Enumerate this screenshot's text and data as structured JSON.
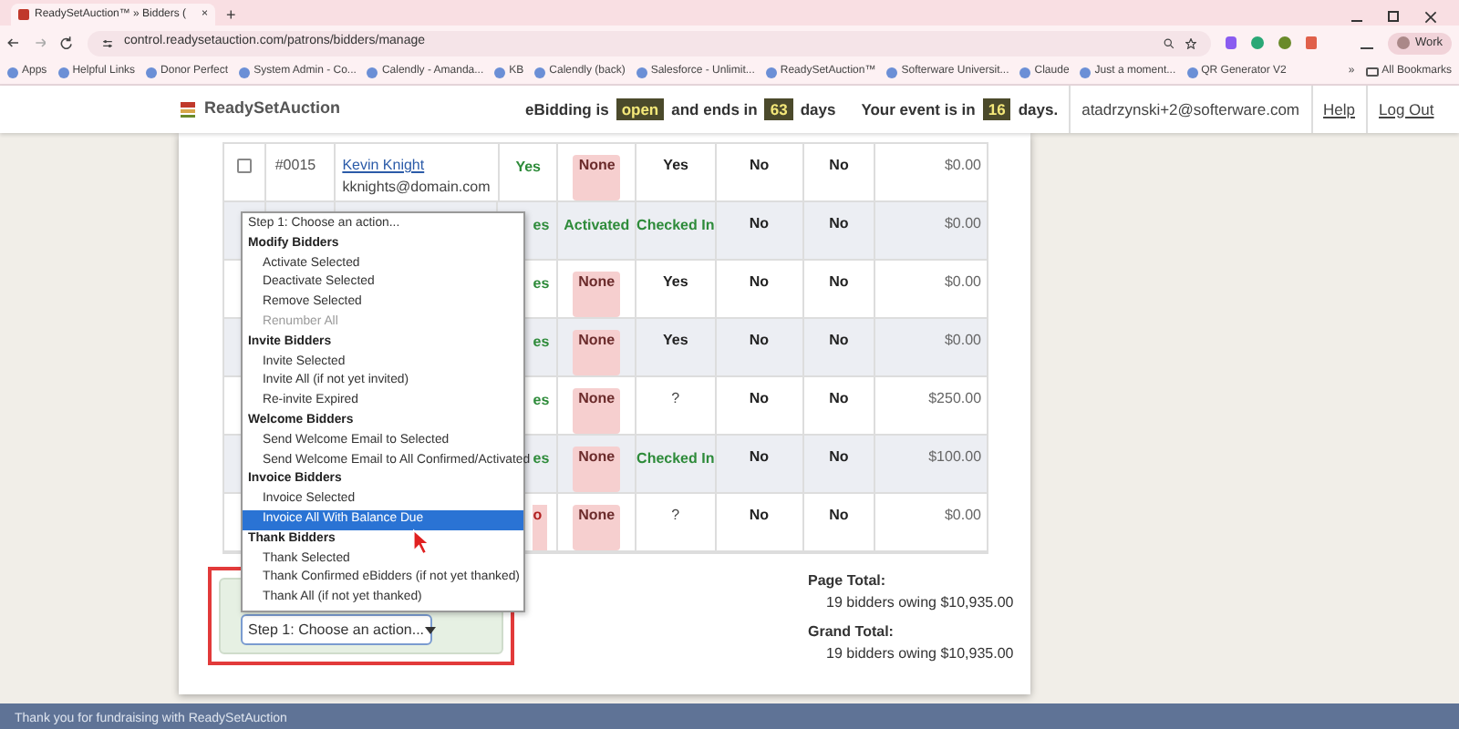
{
  "browser": {
    "tab": {
      "title": "ReadySetAuction™ » Bidders (",
      "close": "×"
    },
    "new_tab": "+",
    "url": "control.readysetauction.com/patrons/bidders/manage",
    "profile": "Work",
    "bookmarks": [
      "Apps",
      "Helpful Links",
      "Donor Perfect",
      "System Admin - Co...",
      "Calendly - Amanda...",
      "KB",
      "Calendly (back)",
      "Salesforce - Unlimit...",
      "ReadySetAuction™",
      "Softerware Universit...",
      "Claude",
      "Just a moment...",
      "QR Generator V2"
    ],
    "more": "»",
    "all_bookmarks": "All Bookmarks"
  },
  "header": {
    "logo": "ReadySetAuction",
    "status": [
      {
        "kind": "text",
        "text": "eBidding is"
      },
      {
        "kind": "pill",
        "text": "open"
      },
      {
        "kind": "text",
        "text": "and ends in"
      },
      {
        "kind": "pill",
        "text": "63"
      },
      {
        "kind": "text",
        "text": "days"
      },
      {
        "kind": "text",
        "text": "Your event is in"
      },
      {
        "kind": "pill",
        "text": "16"
      },
      {
        "kind": "text",
        "text": "days."
      }
    ],
    "user": "atadrzynski+2@softerware.com",
    "links": [
      "Help",
      "Log Out"
    ]
  },
  "table": {
    "rows": [
      {
        "checked": false,
        "number": "#0015",
        "name": "Kevin Knight",
        "email": "kknights@domain.com",
        "cells": [
          {
            "kind": "green",
            "text": "Yes"
          },
          {
            "kind": "pill",
            "text": "None"
          },
          {
            "kind": "bold",
            "text": "Yes"
          },
          {
            "kind": "bold",
            "text": "No"
          },
          {
            "kind": "bold",
            "text": "No"
          }
        ],
        "amount": "$0.00"
      },
      {
        "cells": [
          {
            "kind": "green",
            "text": "es"
          },
          {
            "kind": "green",
            "text": "Activated"
          },
          {
            "kind": "green",
            "text": "Checked In"
          },
          {
            "kind": "bold",
            "text": "No"
          },
          {
            "kind": "bold",
            "text": "No"
          }
        ],
        "amount": "$0.00"
      },
      {
        "cells": [
          {
            "kind": "green",
            "text": "es"
          },
          {
            "kind": "pill",
            "text": "None"
          },
          {
            "kind": "bold",
            "text": "Yes"
          },
          {
            "kind": "bold",
            "text": "No"
          },
          {
            "kind": "bold",
            "text": "No"
          }
        ],
        "amount": "$0.00"
      },
      {
        "cells": [
          {
            "kind": "green",
            "text": "es"
          },
          {
            "kind": "pill",
            "text": "None"
          },
          {
            "kind": "bold",
            "text": "Yes"
          },
          {
            "kind": "bold",
            "text": "No"
          },
          {
            "kind": "bold",
            "text": "No"
          }
        ],
        "amount": "$0.00"
      },
      {
        "cells": [
          {
            "kind": "green",
            "text": "es"
          },
          {
            "kind": "pill",
            "text": "None"
          },
          {
            "kind": "plain",
            "text": "?"
          },
          {
            "kind": "bold",
            "text": "No"
          },
          {
            "kind": "bold",
            "text": "No"
          }
        ],
        "amount": "$250.00"
      },
      {
        "cells": [
          {
            "kind": "green",
            "text": "es"
          },
          {
            "kind": "pill",
            "text": "None"
          },
          {
            "kind": "green",
            "text": "Checked In"
          },
          {
            "kind": "bold",
            "text": "No"
          },
          {
            "kind": "bold",
            "text": "No"
          }
        ],
        "amount": "$100.00"
      },
      {
        "cells": [
          {
            "kind": "redpill",
            "text": "o"
          },
          {
            "kind": "pill",
            "text": "None"
          },
          {
            "kind": "plain",
            "text": "?"
          },
          {
            "kind": "bold",
            "text": "No"
          },
          {
            "kind": "bold",
            "text": "No"
          }
        ],
        "amount": "$0.00"
      }
    ]
  },
  "action_menu": {
    "items": [
      {
        "kind": "prompt",
        "text": "Step 1: Choose an action...",
        "selected": false
      },
      {
        "kind": "group",
        "text": "Modify Bidders",
        "selected": false
      },
      {
        "kind": "option",
        "text": "Activate Selected",
        "selected": false
      },
      {
        "kind": "option",
        "text": "Deactivate Selected",
        "selected": false
      },
      {
        "kind": "option",
        "text": "Remove Selected",
        "selected": false
      },
      {
        "kind": "disabled",
        "text": "Renumber All",
        "selected": false
      },
      {
        "kind": "group",
        "text": "Invite Bidders",
        "selected": false
      },
      {
        "kind": "option",
        "text": "Invite Selected",
        "selected": false
      },
      {
        "kind": "option",
        "text": "Invite All (if not yet invited)",
        "selected": false
      },
      {
        "kind": "option",
        "text": "Re-invite Expired",
        "selected": false
      },
      {
        "kind": "group",
        "text": "Welcome Bidders",
        "selected": false
      },
      {
        "kind": "option",
        "text": "Send Welcome Email to Selected",
        "selected": false
      },
      {
        "kind": "option",
        "text": "Send Welcome Email to All Confirmed/Activated",
        "selected": false
      },
      {
        "kind": "group",
        "text": "Invoice Bidders",
        "selected": false
      },
      {
        "kind": "option",
        "text": "Invoice Selected",
        "selected": false
      },
      {
        "kind": "option",
        "text": "Invoice All With Balance Due",
        "selected": true
      },
      {
        "kind": "group",
        "text": "Thank Bidders",
        "selected": false
      },
      {
        "kind": "option",
        "text": "Thank Selected",
        "selected": false
      },
      {
        "kind": "option",
        "text": "Thank Confirmed eBidders (if not yet thanked)",
        "selected": false
      },
      {
        "kind": "option",
        "text": "Thank All (if not yet thanked)",
        "selected": false
      }
    ]
  },
  "action_select": {
    "value": "Step 1: Choose an action..."
  },
  "totals": [
    {
      "label": "Page Total:",
      "value": "19 bidders owing $10,935.00"
    },
    {
      "label": "Grand Total:",
      "value": "19 bidders owing $10,935.00"
    }
  ],
  "footer": {
    "text": "Thank you for fundraising with ReadySetAuction"
  }
}
